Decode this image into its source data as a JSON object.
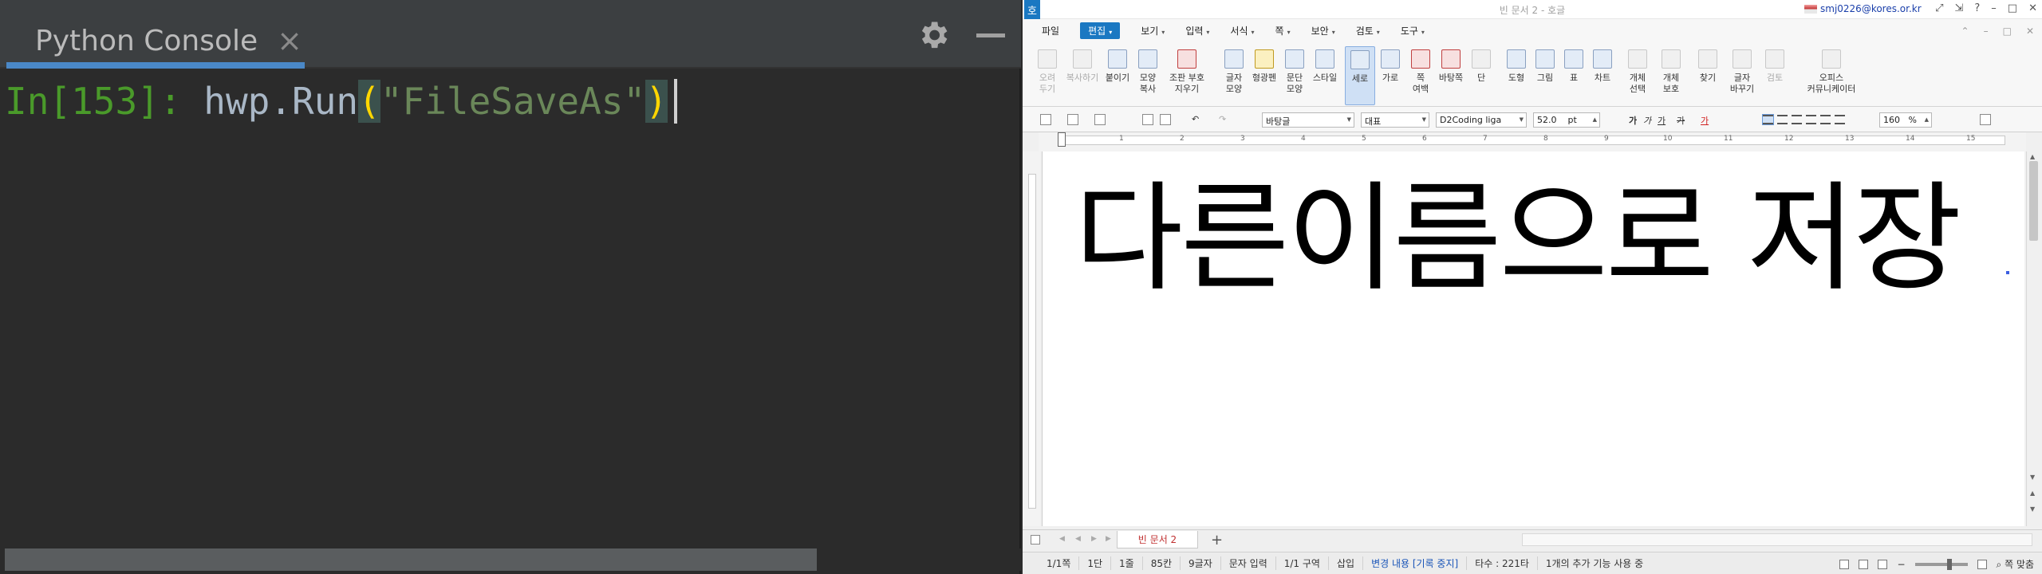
{
  "console": {
    "tab_label": "Python Console",
    "close_glyph": "×",
    "prompt": "In[153]: ",
    "code_ident": "hwp.Run",
    "code_open_paren": "(",
    "code_string": "\"FileSaveAs\"",
    "code_close_paren": ")"
  },
  "hwp": {
    "window_title": "빈 문서 2 - 호글",
    "user_email": "smj0226@kores.or.kr",
    "logo_glyph": "호",
    "menus": [
      {
        "label": "파일"
      },
      {
        "label": "편집"
      },
      {
        "label": "보기"
      },
      {
        "label": "입력"
      },
      {
        "label": "서식"
      },
      {
        "label": "쪽"
      },
      {
        "label": "보안"
      },
      {
        "label": "검토"
      },
      {
        "label": "도구"
      }
    ],
    "menu_dropdown_glyph": "▾",
    "ribbon": {
      "cut": "오려\n두기",
      "copy": "복사하기",
      "paste": "붙이기",
      "format_copy": "모양\n복사",
      "remove_marks": "조판 부호\n지우기",
      "char_shape": "글자\n모양",
      "highlighter": "형광펜",
      "para_shape": "문단\n모양",
      "style": "스타일",
      "portrait": "세로",
      "landscape": "가로",
      "page_margin": "쪽\n여백",
      "background": "바탕쪽",
      "columns": "단",
      "shapes": "도형",
      "picture": "그림",
      "table": "표",
      "chart": "차트",
      "select_object": "개체\n선택",
      "protect_object": "개체\n보호",
      "find": "찾기",
      "replace": "글자\n바꾸기",
      "spell": "검토",
      "office_community": "오피스\n커뮤니케이터"
    },
    "toolbar": {
      "font_lang": "바탕글",
      "style": "대표",
      "font": "D2Coding liga",
      "size": "52.0",
      "size_unit": "pt",
      "zoom": "160",
      "zoom_unit": "%",
      "bold": "가",
      "italic": "가",
      "underline": "가",
      "strike": "가",
      "color": "가"
    },
    "ruler_numbers": [
      "1",
      "2",
      "3",
      "4",
      "5",
      "6",
      "7",
      "8",
      "9",
      "10",
      "11",
      "12",
      "13",
      "14",
      "15"
    ],
    "doc_text": "다른이름으로 저장",
    "doc_tab": "빈 문서 2",
    "add_tab_glyph": "+",
    "status": [
      {
        "text": "1/1쪽"
      },
      {
        "text": "1단"
      },
      {
        "text": "1줄"
      },
      {
        "text": "85칸"
      },
      {
        "text": "9글자"
      },
      {
        "text": "문자 입력"
      },
      {
        "text": "1/1 구역"
      },
      {
        "text": "삽입"
      },
      {
        "text": "변경 내용 [기록 중지]"
      },
      {
        "text": "타수 : 221타"
      },
      {
        "text": "1개의 추가 기능 사용 중"
      }
    ],
    "fit_page": "쪽 맞춤"
  }
}
